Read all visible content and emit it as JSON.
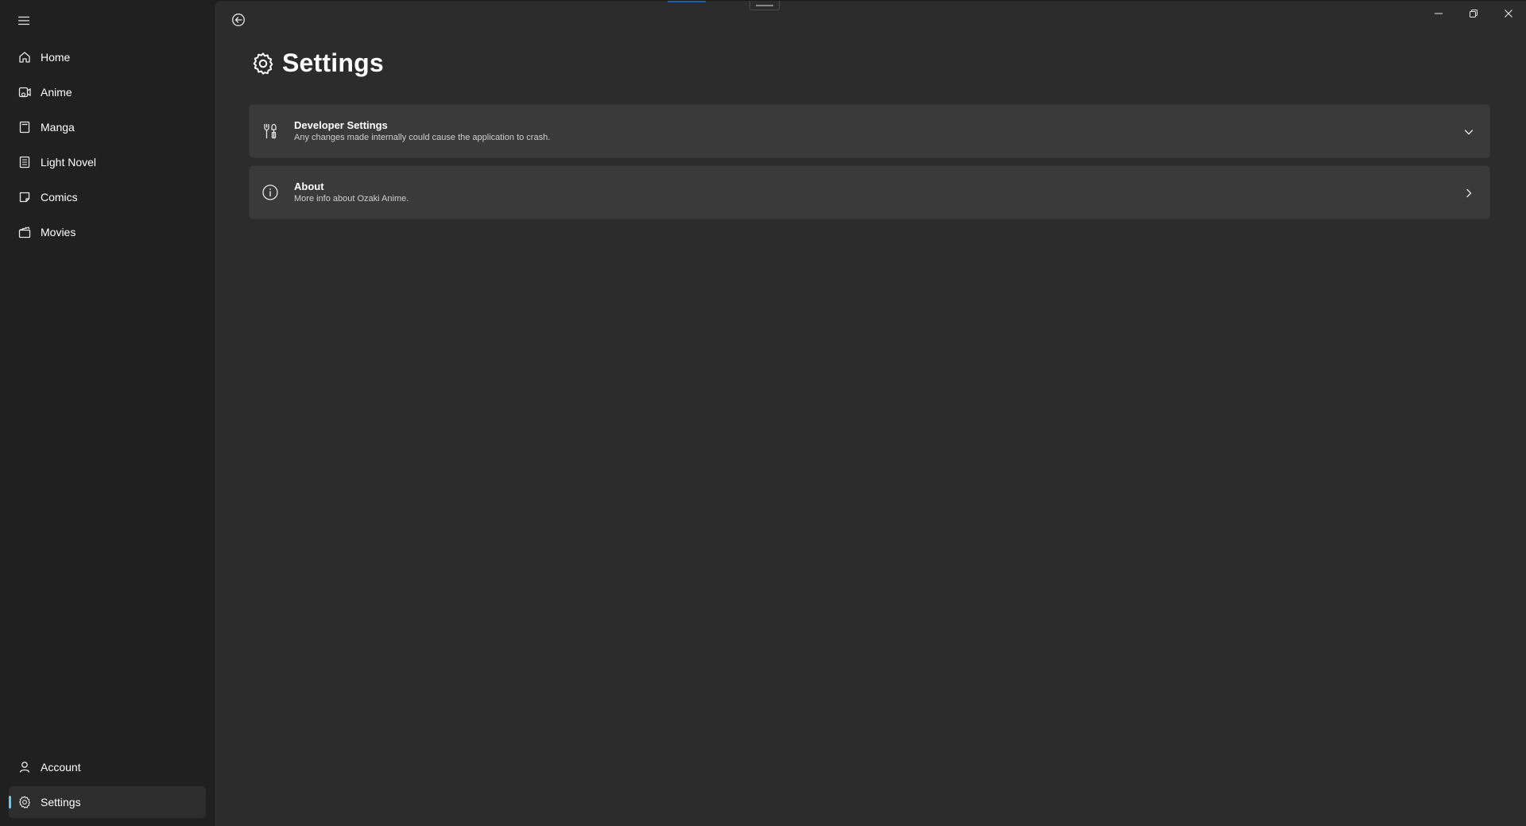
{
  "sidebar": {
    "menu_icon": "hamburger-icon",
    "items": [
      {
        "label": "Home",
        "icon": "home-icon"
      },
      {
        "label": "Anime",
        "icon": "anime-icon"
      },
      {
        "label": "Manga",
        "icon": "manga-icon"
      },
      {
        "label": "Light Novel",
        "icon": "light-novel-icon"
      },
      {
        "label": "Comics",
        "icon": "comics-icon"
      },
      {
        "label": "Movies",
        "icon": "movies-icon"
      }
    ],
    "footer_items": [
      {
        "label": "Account",
        "icon": "person-icon"
      },
      {
        "label": "Settings",
        "icon": "gear-icon",
        "selected": true
      }
    ]
  },
  "header": {
    "title": "Settings",
    "title_icon": "gear-icon"
  },
  "cards": [
    {
      "title": "Developer Settings",
      "description": "Any changes made internally could cause the application to crash.",
      "icon": "tools-icon",
      "chevron": "chevron-down-icon"
    },
    {
      "title": "About",
      "description": "More info about Ozaki Anime.",
      "icon": "info-icon",
      "chevron": "chevron-right-icon"
    }
  ],
  "colors": {
    "background": "#202020",
    "content": "#2c2c2c",
    "card": "#3a3a3a",
    "accent": "#60cdff"
  }
}
